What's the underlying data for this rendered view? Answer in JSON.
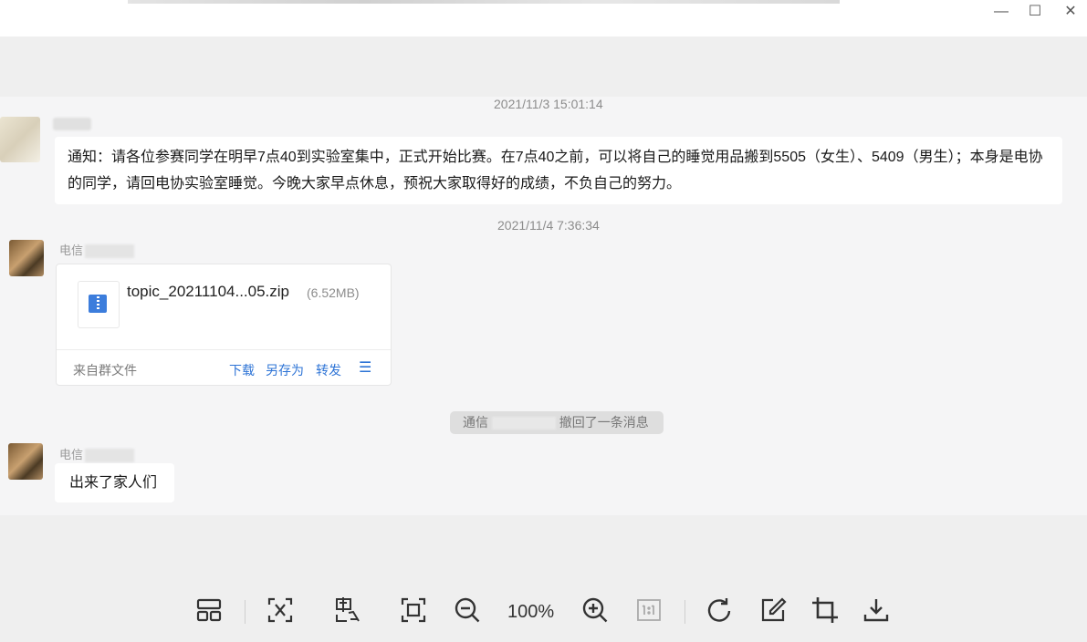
{
  "window": {
    "controls": {
      "minimize": "—",
      "maximize": "☐",
      "close": "✕"
    }
  },
  "chat": {
    "timestamp_1": "2021/11/3 15:01:14",
    "notice_message": "通知：请各位参赛同学在明早7点40到实验室集中，正式开始比赛。在7点40之前，可以将自己的睡觉用品搬到5505（女生）、5409（男生）；本身是电协的同学，请回电协实验室睡觉。今晚大家早点休息，预祝大家取得好的成绩，不负自己的努力。",
    "timestamp_2": "2021/11/4 7:36:34",
    "sender_2": "电信",
    "file": {
      "name": "topic_20211104...05.zip",
      "size": "(6.52MB)",
      "source": "来自群文件",
      "actions": {
        "download": "下载",
        "save_as": "另存为",
        "forward": "转发",
        "more": "☰"
      }
    },
    "recall_notice_prefix": "通信",
    "recall_notice_suffix": "撤回了一条消息",
    "sender_3": "电信",
    "short_message": "出来了家人们"
  },
  "toolbar": {
    "zoom_level": "100%",
    "icons": [
      "gallery-icon",
      "ocr-icon",
      "translate-icon",
      "fit-screen-icon",
      "zoom-out-icon",
      "zoom-in-icon",
      "actual-size-icon",
      "rotate-icon",
      "edit-icon",
      "crop-icon",
      "download-icon"
    ]
  },
  "colors": {
    "accent": "#2e74d6",
    "background": "#f2f2f2",
    "bubble": "#ffffff"
  }
}
